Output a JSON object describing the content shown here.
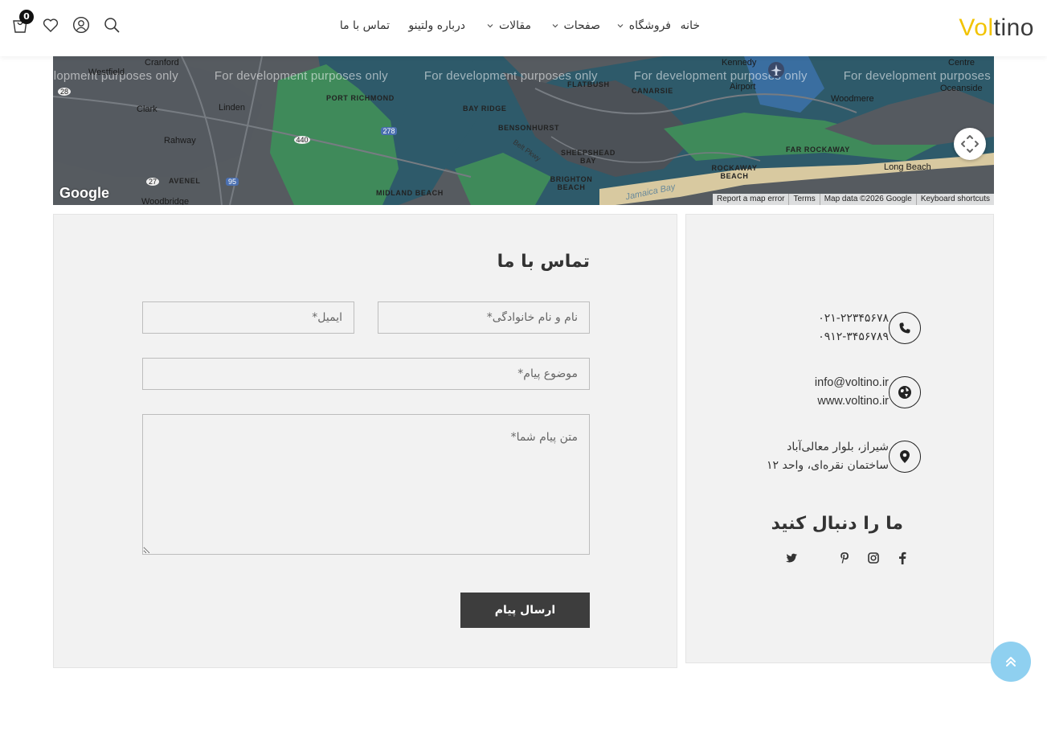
{
  "header": {
    "logo_part1": "Vol",
    "logo_part2": "tino",
    "nav": [
      {
        "label": "خانه",
        "dropdown": false
      },
      {
        "label": "فروشگاه",
        "dropdown": true
      },
      {
        "label": "صفحات",
        "dropdown": true
      },
      {
        "label": "مقالات",
        "dropdown": true
      },
      {
        "label": "درباره ولتینو",
        "dropdown": false
      },
      {
        "label": "تماس با ما",
        "dropdown": false
      }
    ],
    "cart_count": "0",
    "icons": [
      "search-icon",
      "user-icon",
      "heart-icon",
      "cart-icon"
    ]
  },
  "map": {
    "watermark": "For development purposes only",
    "labels": {
      "cranford": "Cranford",
      "westfield": "Westfield",
      "clark": "Clark",
      "linden": "Linden",
      "rahway": "Rahway",
      "avenel": "AVENEL",
      "woodbridge": "Woodbridge",
      "port_richmond": "PORT RICHMOND",
      "bay_ridge": "BAY RIDGE",
      "bensonhurst": "BENSONHURST",
      "flatbush": "FLATBUSH",
      "canarsie": "CANARSIE",
      "sheepshead_bay": "SHEEPSHEAD BAY",
      "brighton_beach": "BRIGHTON BEACH",
      "midland_beach": "MIDLAND BEACH",
      "kennedy": "Kennedy",
      "airport": "Airport",
      "woodmere": "Woodmere",
      "far_rockaway": "FAR ROCKAWAY",
      "rockaway_beach": "ROCKAWAY BEACH",
      "long_beach": "Long Beach",
      "oceanside": "Oceanside",
      "centre": "Centre",
      "jamaica_bay": "Jamaica Bay",
      "belt_pkwy": "Belt Pkwy",
      "shield_28": "28",
      "shield_27": "27",
      "shield_95": "95",
      "shield_440": "440",
      "shield_278": "278"
    },
    "google_logo": "Google",
    "attribution": [
      "Report a map error",
      "Terms",
      "Map data ©2026 Google",
      "Keyboard shortcuts"
    ]
  },
  "form": {
    "title": "تماس با ما",
    "name_placeholder": "نام و نام خانوادگی*",
    "email_placeholder": "ایمیل*",
    "subject_placeholder": "موضوع پیام*",
    "message_placeholder": "متن پیام شما*",
    "submit_label": "ارسال پیام"
  },
  "info": {
    "phone1": "۰۲۱-۲۲۳۴۵۶۷۸",
    "phone2": "۰۹۱۲-۳۴۵۶۷۸۹",
    "email": "info@voltino.ir",
    "website": "www.voltino.ir",
    "address1": "شیراز، بلوار معالی‌آباد",
    "address2": "ساختمان نقره‌ای، واحد ۱۲",
    "follow_title": "ما را دنبال کنید",
    "socials": [
      "facebook-icon",
      "instagram-icon",
      "pinterest-icon",
      "twitter-icon"
    ]
  },
  "colors": {
    "logo_accent": "#f2c300",
    "button_bg": "#3d3d3d",
    "panel_bg": "#f2f2f2",
    "back_to_top": "#8fd0f0"
  }
}
